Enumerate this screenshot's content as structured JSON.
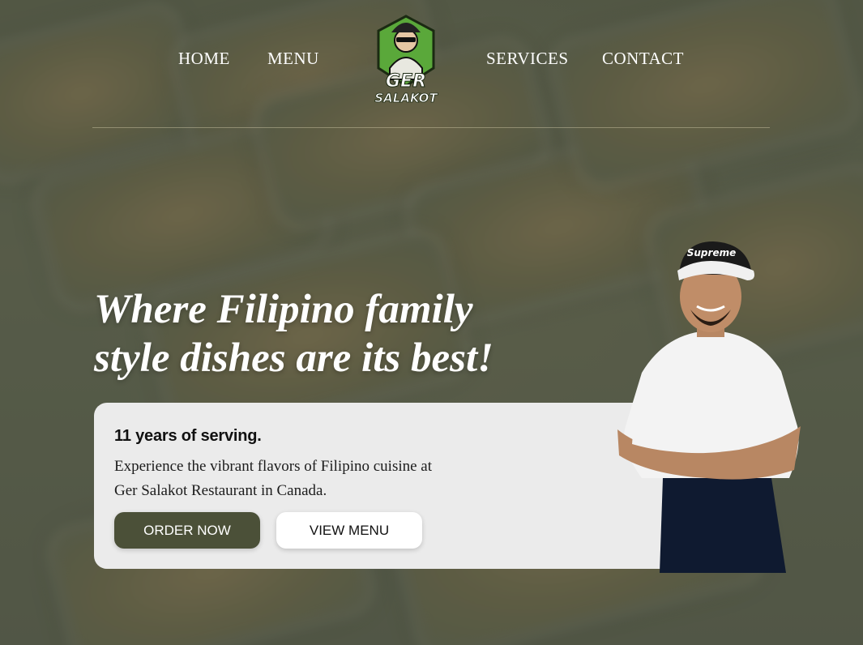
{
  "nav": {
    "items": [
      "HOME",
      "MENU",
      "SERVICES",
      "CONTACT"
    ]
  },
  "logo": {
    "line1": "GER",
    "line2": "SALAKOT"
  },
  "hero": {
    "headline_line1": "Where Filipino family",
    "headline_line2": "style dishes are its best!"
  },
  "card": {
    "title": "11 years of serving.",
    "desc_line1": "Experience the vibrant flavors of Filipino cuisine at",
    "desc_line2": "Ger Salakot Restaurant in Canada.",
    "order_label": "ORDER NOW",
    "view_label": "VIEW MENU"
  },
  "chef": {
    "cap_text": "Supreme"
  },
  "colors": {
    "accent": "#4b5038",
    "card_bg": "#ebebeb",
    "logo_green": "#5aa83a"
  }
}
